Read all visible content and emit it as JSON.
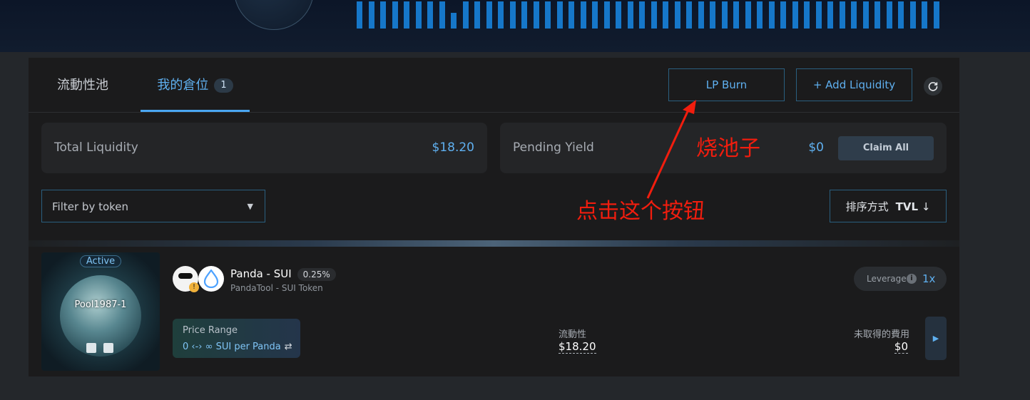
{
  "header_banner": {},
  "tabs": [
    {
      "label": "流動性池"
    },
    {
      "label": "我的倉位",
      "count": "1"
    }
  ],
  "actions": {
    "lp_burn_label": "LP Burn",
    "add_liquidity_label": "+ Add Liquidity",
    "refresh_icon": "refresh-icon"
  },
  "stats": {
    "total_liquidity_label": "Total Liquidity",
    "total_liquidity_value": "$18.20",
    "pending_yield_label": "Pending Yield",
    "pending_yield_value": "$0",
    "claim_all_label": "Claim All"
  },
  "filter": {
    "placeholder": "Filter by token"
  },
  "sort": {
    "label": "排序方式",
    "value": "TVL",
    "direction_icon": "↓"
  },
  "position": {
    "nft_status": "Active",
    "nft_name": "Pool1987-1",
    "pair": "Panda - SUI",
    "fee_tier": "0.25%",
    "subtitle": "PandaTool - SUI Token",
    "leverage_label": "Leverage",
    "leverage_value": "1x",
    "price_range_label": "Price Range",
    "price_range_value": "0 ‹-› ∞ SUI per Panda",
    "liquidity_label": "流動性",
    "liquidity_value": "$18.20",
    "unclaimed_fees_label": "未取得的費用",
    "unclaimed_fees_value": "$0"
  },
  "annotations": {
    "burn_note": "烧池子",
    "click_note": "点击这个按钮",
    "color": "#f11d0e"
  },
  "colors": {
    "accent": "#5fb0f0",
    "panel": "#1b1b1c",
    "background": "#24272b"
  }
}
